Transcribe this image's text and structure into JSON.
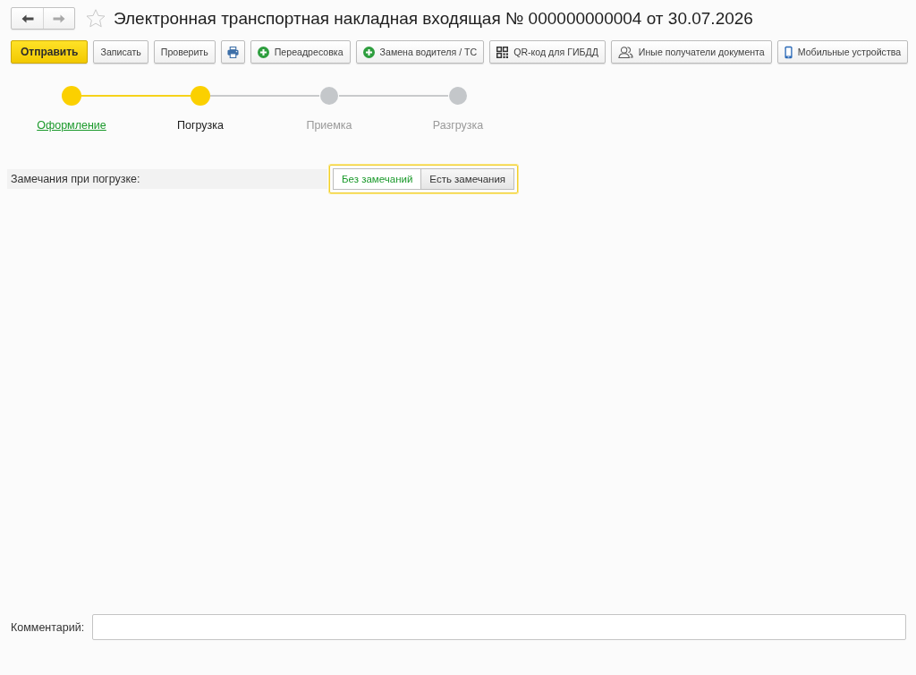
{
  "window": {
    "title": "Электронная транспортная накладная входящая № 000000000004 от 30.07.2026",
    "favorite": false
  },
  "navigation": [
    {
      "kind": "back",
      "disabled": false
    },
    {
      "kind": "forward",
      "disabled": true
    }
  ],
  "toolbar": [
    {
      "label": "Отправить",
      "kind": "default"
    },
    {
      "label": "Записать",
      "kind": "plain"
    },
    {
      "label": "Проверить",
      "kind": "plain"
    },
    {
      "kind": "print"
    },
    {
      "label": "Переадресовка",
      "kind": "add"
    },
    {
      "label": "Замена водителя / ТС",
      "kind": "add"
    },
    {
      "label": "QR-код для ГИБДД",
      "kind": "qr"
    },
    {
      "label": "Иные получатели документа",
      "kind": "people"
    },
    {
      "label": "Мобильные устройства",
      "kind": "mobile"
    }
  ],
  "steps": [
    {
      "label": "Оформление",
      "reached": true,
      "current": false
    },
    {
      "label": "Погрузка",
      "reached": true,
      "current": true
    },
    {
      "label": "Приемка",
      "reached": false,
      "current": false
    },
    {
      "label": "Разгрузка",
      "reached": false,
      "current": false
    }
  ],
  "remarks": {
    "label": "Замечания при погрузке:",
    "focused": true,
    "options": [
      {
        "label": "Без замечаний",
        "selected": true
      },
      {
        "label": "Есть замечания",
        "selected": false
      }
    ]
  },
  "comment": {
    "label": "Комментарий:"
  }
}
